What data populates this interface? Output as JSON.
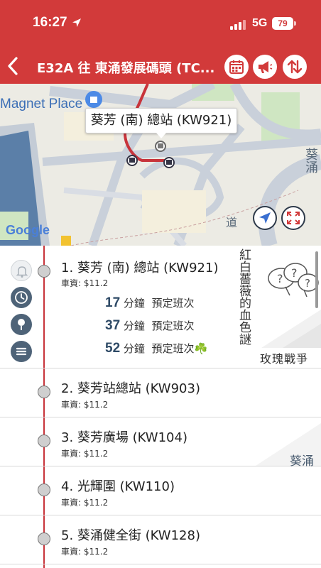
{
  "status_bar": {
    "time": "16:27",
    "network": "5G",
    "battery": "79"
  },
  "header": {
    "title": "E32A 往 東涌發展碼頭 (TC...",
    "background_color": "#d23a3a"
  },
  "map": {
    "poi_label": "Magnet Place",
    "selected_stop_bubble": "葵芳 (南) 總站 (KW921)",
    "attribution": "Google",
    "street_label_1": "葵涌",
    "street_label_2": "道"
  },
  "stops": [
    {
      "name": "1. 葵芳 (南) 總站 (KW921)",
      "fare": "車資: $11.2",
      "etas": [
        {
          "minutes": "17",
          "unit": "分鐘",
          "note": "預定班次"
        },
        {
          "minutes": "37",
          "unit": "分鐘",
          "note": "預定班次"
        },
        {
          "minutes": "52",
          "unit": "分鐘",
          "note": "預定班次☘️"
        }
      ]
    },
    {
      "name": "2. 葵芳站總站 (KW903)",
      "fare": "車資: $11.2"
    },
    {
      "name": "3. 葵芳廣場 (KW104)",
      "fare": "車資: $11.2"
    },
    {
      "name": "4. 光輝圍 (KW110)",
      "fare": "車資: $11.2"
    },
    {
      "name": "5. 葵涌健全街 (KW128)",
      "fare": "車資: $11.2"
    }
  ],
  "ad": {
    "vertical_text": "紅白薔薇的血色謎",
    "horizontal_text": "玫瑰戰爭"
  },
  "side_label": "葵涌",
  "icons": {
    "back": "chevron-left-icon",
    "calendar": "calendar-icon",
    "announce": "megaphone-icon",
    "reverse": "swap-vertical-icon",
    "locate": "navigation-arrow-icon",
    "expand": "expand-icon",
    "bell": "bell-icon",
    "clock": "clock-icon",
    "pin": "map-pin-icon",
    "menu": "menu-icon"
  }
}
